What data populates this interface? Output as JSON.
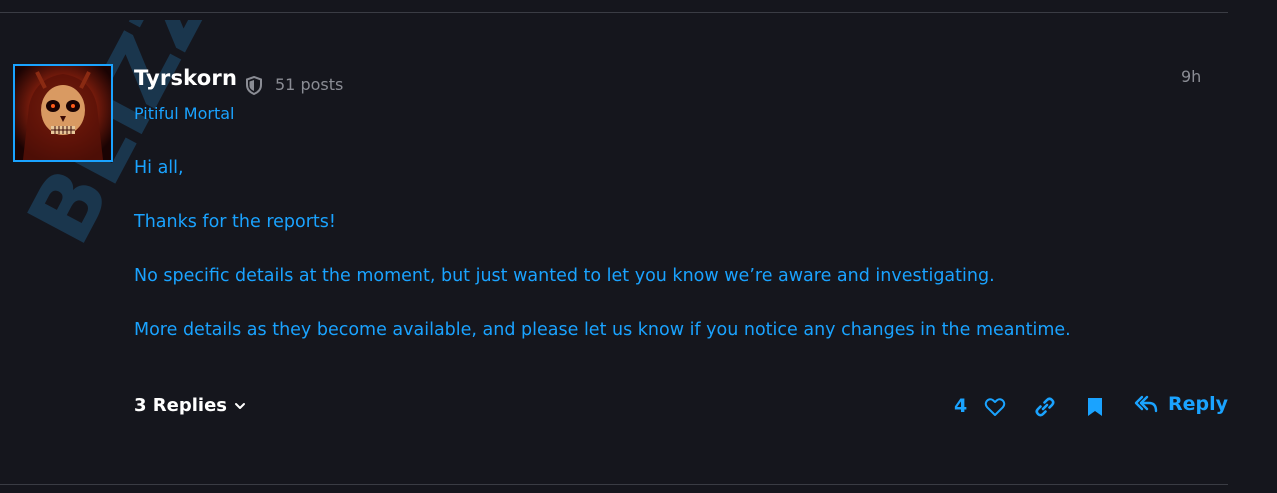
{
  "post": {
    "author": {
      "name": "Tyrskorn",
      "posts_count": "51 posts",
      "rank": "Pitiful Mortal"
    },
    "timestamp": "9h",
    "body": [
      "Hi all,",
      "Thanks for the reports!",
      "No specific details at the moment, but just wanted to let you know we’re aware and investigating.",
      "More details as they become available, and please let us know if you notice any changes in the meantime."
    ],
    "watermark": "BLIZZARD"
  },
  "footer": {
    "replies_label": "3 Replies",
    "like_count": "4",
    "reply_label": "Reply"
  },
  "icons": [
    "shield-icon",
    "chevron-down-icon",
    "heart-icon",
    "link-icon",
    "bookmark-icon",
    "reply-icon"
  ],
  "colors": {
    "background": "#15161d",
    "accent": "#1aa3ff",
    "muted": "#8a8c94",
    "text": "#ffffff"
  }
}
